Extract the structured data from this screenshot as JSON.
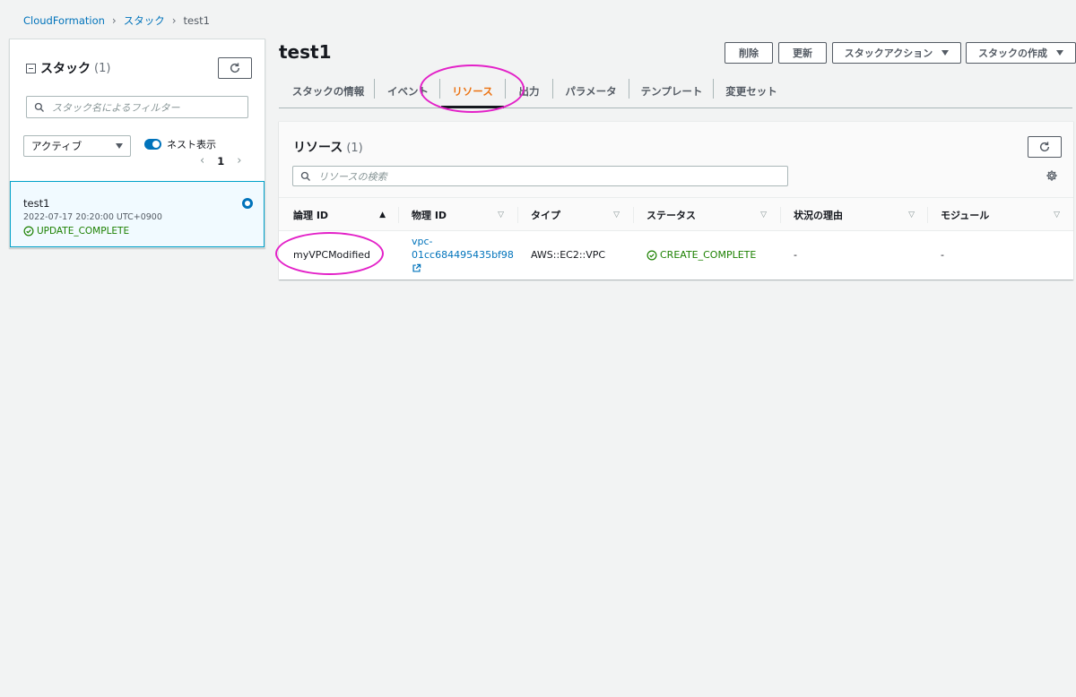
{
  "breadcrumb": {
    "root": "CloudFormation",
    "stacks": "スタック",
    "current": "test1"
  },
  "left_panel": {
    "title": "スタック",
    "count": "(1)",
    "filter_placeholder": "スタック名によるフィルター",
    "status_filter": "アクティブ",
    "nested_toggle": "ネスト表示",
    "page": "1",
    "stack": {
      "name": "test1",
      "created": "2022-07-17 20:20:00 UTC+0900",
      "status": "UPDATE_COMPLETE"
    }
  },
  "header": {
    "title": "test1",
    "buttons": {
      "delete": "削除",
      "update": "更新",
      "stack_actions": "スタックアクション",
      "create_stack": "スタックの作成"
    }
  },
  "tabs": [
    "スタックの情報",
    "イベント",
    "リソース",
    "出力",
    "パラメータ",
    "テンプレート",
    "変更セット"
  ],
  "active_tab": "リソース",
  "resources": {
    "title": "リソース",
    "count": "(1)",
    "search_placeholder": "リソースの検索",
    "columns": [
      "論理 ID",
      "物理 ID",
      "タイプ",
      "ステータス",
      "状況の理由",
      "モジュール"
    ],
    "rows": [
      {
        "logical_id": "myVPCModified",
        "physical_id_line1": "vpc-",
        "physical_id_line2": "01cc684495435bf98",
        "type": "AWS::EC2::VPC",
        "status": "CREATE_COMPLETE",
        "reason": "-",
        "module": "-"
      }
    ]
  },
  "colors": {
    "link": "#0073bb",
    "success": "#1d8102",
    "active_tab": "#ec7211",
    "highlight": "#e321c8"
  }
}
